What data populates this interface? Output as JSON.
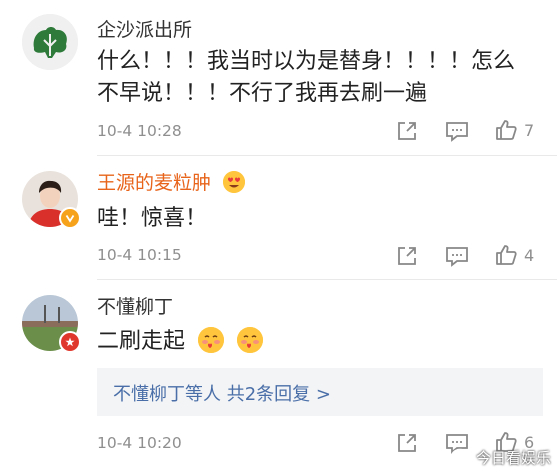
{
  "comments": [
    {
      "username": "企沙派出所",
      "text_line1": "什么！！！我当时以为是替身！！！！怎么",
      "text_line2": "不早说！！！不行了我再去刷一遍",
      "time": "10-4 10:28",
      "like_count": "7",
      "avatar_icon": "cabbage-logo-icon"
    },
    {
      "username": "王源的麦粒肿",
      "text_line1": "哇！惊喜！",
      "time": "10-4 10:15",
      "like_count": "4",
      "username_color": "#e8641b",
      "avatar_icon": "person-photo-avatar"
    },
    {
      "username": "不懂柳丁",
      "text_line1": "二刷走起",
      "time": "10-4 10:20",
      "like_count": "6",
      "avatar_icon": "stadium-photo-avatar",
      "replies_label": "不懂柳丁等人  共2条回复 >"
    }
  ],
  "watermark": "今日看娱乐",
  "colors": {
    "link": "#4a6fa8",
    "meta_gray": "#8f8f8f",
    "verified": "#f7a21b",
    "red_badge": "#e0372c"
  }
}
